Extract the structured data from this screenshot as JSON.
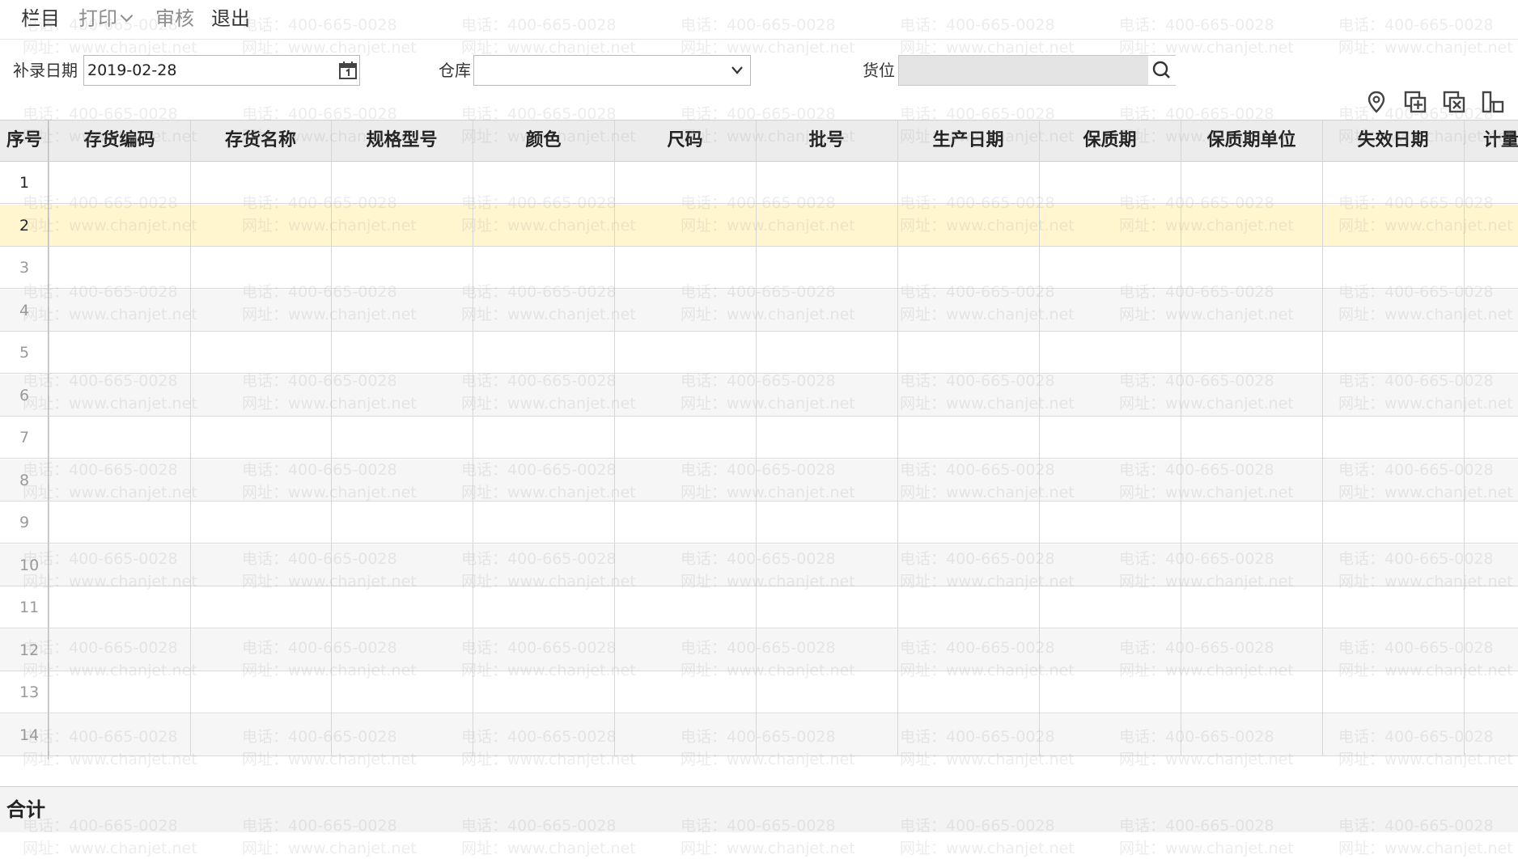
{
  "toolbar": {
    "column": "栏目",
    "print": "打印",
    "review": "审核",
    "exit": "退出"
  },
  "filters": {
    "date_label": "补录日期",
    "date_value": "2019-02-28",
    "warehouse_label": "仓库",
    "warehouse_value": "",
    "location_label": "货位",
    "location_value": ""
  },
  "table": {
    "columns": [
      "序号",
      "存货编码",
      "存货名称",
      "规格型号",
      "颜色",
      "尺码",
      "批号",
      "生产日期",
      "保质期",
      "保质期单位",
      "失效日期",
      "计量"
    ],
    "rows": [
      "1",
      "2",
      "3",
      "4",
      "5",
      "6",
      "7",
      "8",
      "9",
      "10",
      "11",
      "12",
      "13",
      "14"
    ],
    "selected_row": "2"
  },
  "total_label": "合计",
  "watermark": {
    "phone": "电话：400-665-0028",
    "site": "网址：www.chanjet.net"
  },
  "colors": {
    "header_bg": "#ececec",
    "selected_row_bg": "#fff6cf",
    "alt_row_bg": "#f6f6f6"
  }
}
